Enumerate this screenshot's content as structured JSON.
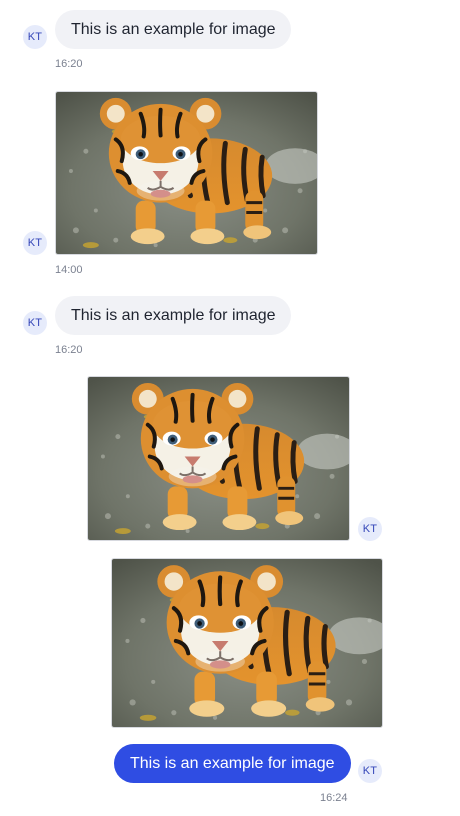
{
  "conversation": {
    "messages": [
      {
        "type": "text",
        "direction": "incoming",
        "avatar_initials": "KT",
        "text": "This is an example for image",
        "time": "16:20"
      },
      {
        "type": "image",
        "direction": "incoming",
        "avatar_initials": "KT",
        "image": "tiger-cub-photo",
        "time": "14:00"
      },
      {
        "type": "text",
        "direction": "incoming",
        "avatar_initials": "KT",
        "text": "This is an example for image",
        "time": "16:20"
      },
      {
        "type": "image",
        "direction": "outgoing",
        "avatar_initials": "KT",
        "image": "tiger-cub-photo"
      },
      {
        "type": "image",
        "direction": "outgoing",
        "image": "tiger-cub-photo"
      },
      {
        "type": "text",
        "direction": "outgoing",
        "avatar_initials": "KT",
        "text": "This is an example for image",
        "time": "16:24"
      }
    ]
  },
  "colors": {
    "incoming_bubble": "#f1f2f6",
    "outgoing_bubble": "#2f4de3",
    "avatar_bg": "#e6ebfb",
    "avatar_text": "#3446b8",
    "timestamp": "#7b8190"
  }
}
